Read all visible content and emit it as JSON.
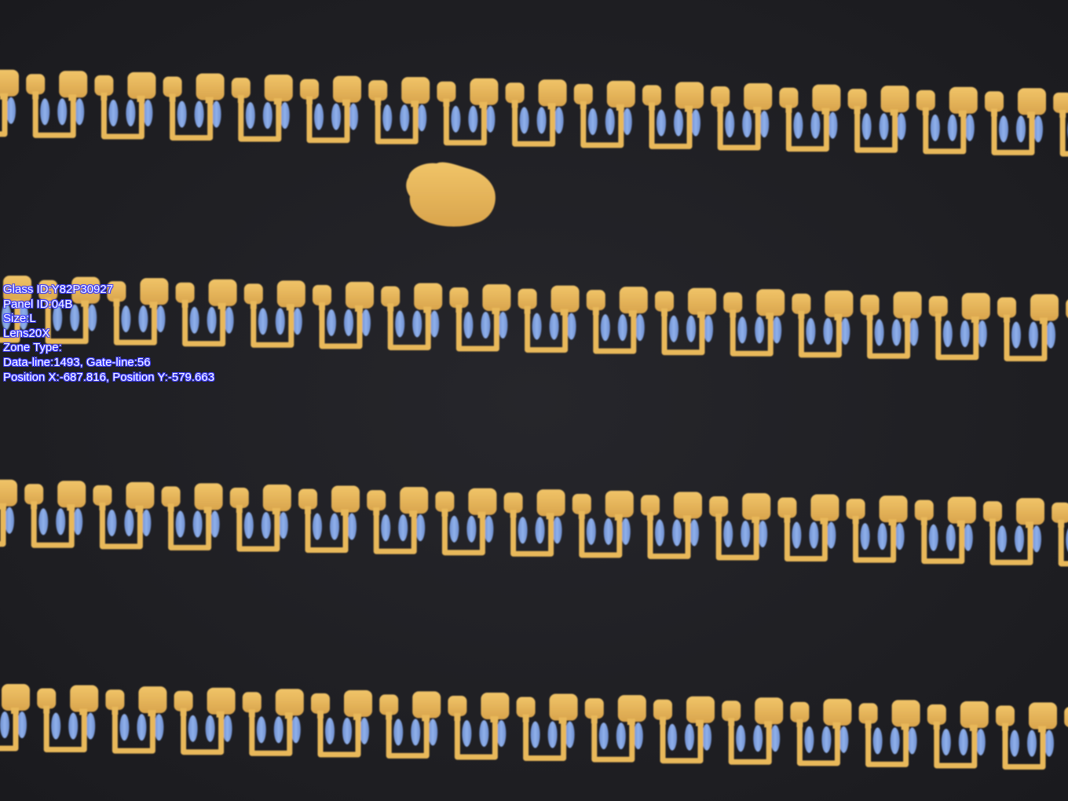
{
  "inspection_overlay": {
    "glass_id": "Glass ID:Y82P30927",
    "panel_id": "Panel ID:04B",
    "size": "Size:L",
    "lens": "Lens20X",
    "zone_type": "Zone Type:",
    "lines": "Data-line:1493, Gate-line:56",
    "position": "Position X:-687.816, Position Y:-579.663"
  },
  "colors": {
    "substrate": "#1f1f23",
    "electrode": "#e8b85a",
    "electrode_highlight": "#f2c870",
    "via": "#7a9ad8",
    "defect": "#ebb552",
    "overlay_text": "#ffffff",
    "overlay_outline": "#3a3aff"
  },
  "image": {
    "pattern_rows": 4,
    "defect_particle_count": 1
  }
}
